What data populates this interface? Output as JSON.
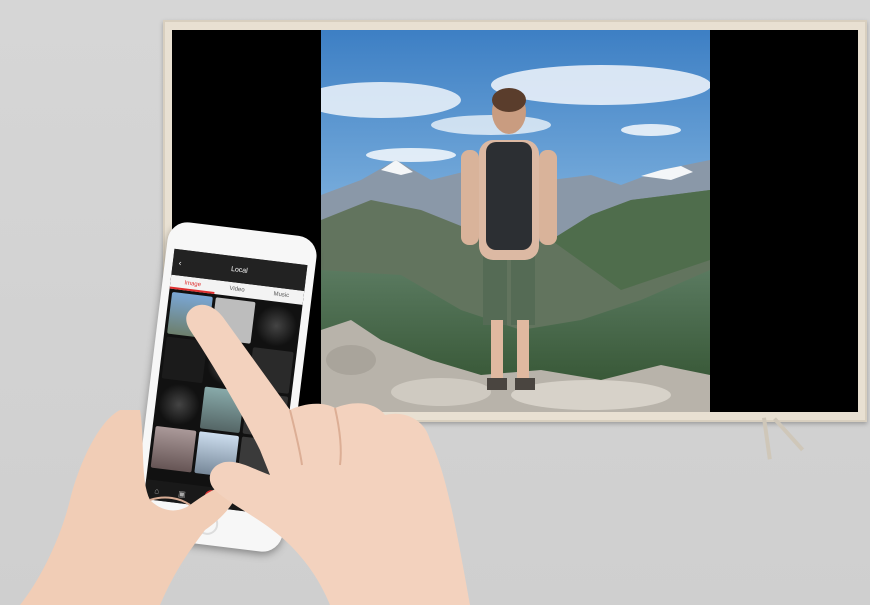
{
  "phone_app": {
    "header_title": "Local",
    "tabs": [
      "Image",
      "Video",
      "Music"
    ],
    "active_tab": "Image",
    "accent_color": "#e03030"
  },
  "scene": {
    "background_color": "#d3d3d3",
    "tv_frame_color": "#e8e0d2"
  }
}
